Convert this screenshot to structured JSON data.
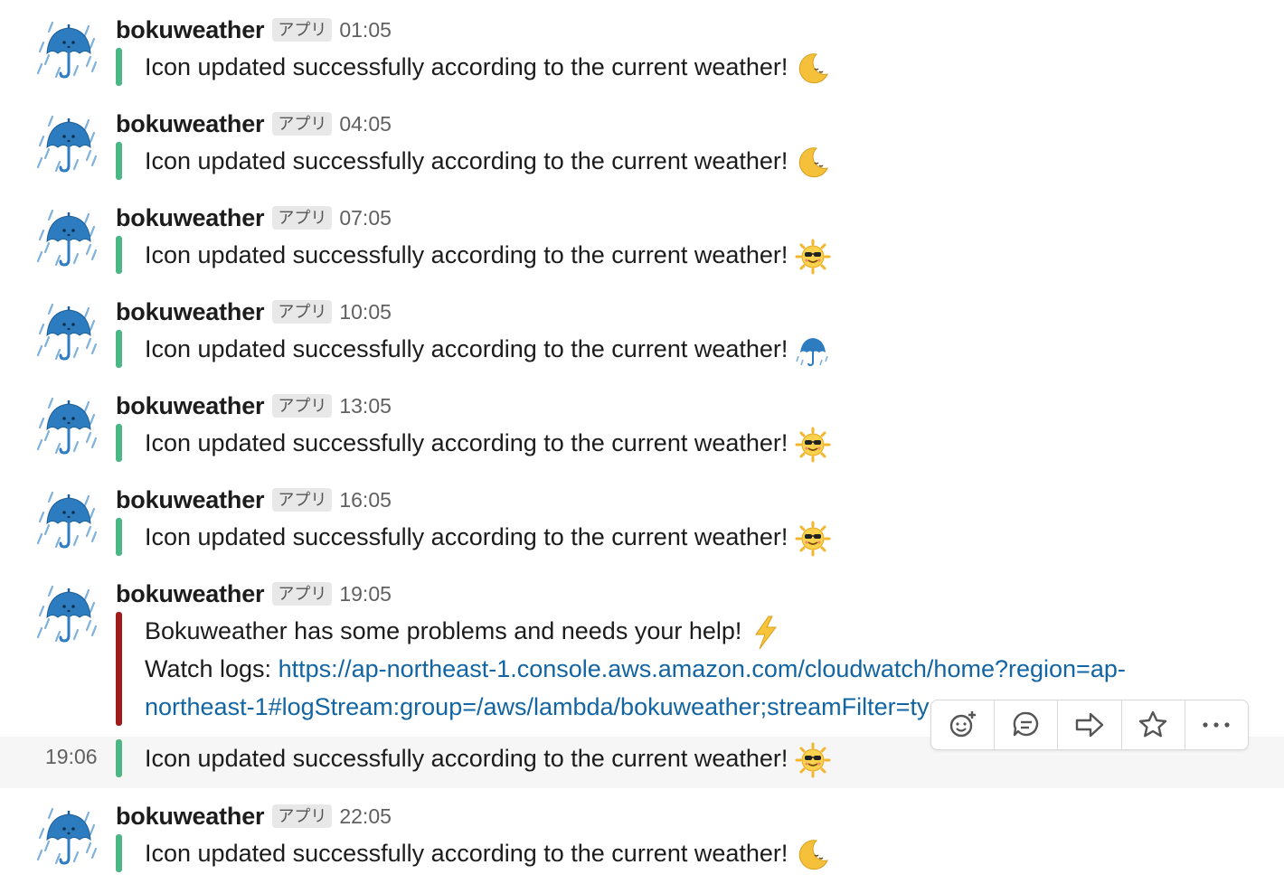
{
  "bot": {
    "name": "bokuweather",
    "badge": "アプリ"
  },
  "messages": [
    {
      "time": "01:05",
      "text": "Icon updated successfully according to the current weather!",
      "emoji": "moon-icon"
    },
    {
      "time": "04:05",
      "text": "Icon updated successfully according to the current weather!",
      "emoji": "moon-icon"
    },
    {
      "time": "07:05",
      "text": "Icon updated successfully according to the current weather!",
      "emoji": "sun-sunglasses-icon"
    },
    {
      "time": "10:05",
      "text": "Icon updated successfully according to the current weather!",
      "emoji": "umbrella-rain-icon"
    },
    {
      "time": "13:05",
      "text": "Icon updated successfully according to the current weather!",
      "emoji": "sun-sunglasses-icon"
    },
    {
      "time": "16:05",
      "text": "Icon updated successfully according to the current weather!",
      "emoji": "sun-sunglasses-icon"
    }
  ],
  "error_message": {
    "time": "19:05",
    "line1": "Bokuweather has some problems and needs your help!",
    "emoji": "lightning-icon",
    "logs_label": "Watch logs: ",
    "link_part1": "https://ap-northeast-1.console.aws.amazon.com/cloudwatch/home?region=ap-",
    "link_part2": "northeast-1#logStream:group=/aws/lambda/bokuweather;streamFilter=typeLogStreamPref"
  },
  "followup": {
    "time": "19:06",
    "text": "Icon updated successfully according to the current weather!",
    "emoji": "sun-sunglasses-icon"
  },
  "last_message": {
    "time": "22:05",
    "text": "Icon updated successfully according to the current weather!",
    "emoji": "moon-icon"
  },
  "toolbar": {
    "actions": [
      "add-reaction",
      "reply-in-thread",
      "share-message",
      "save-item",
      "more-actions"
    ]
  },
  "colors": {
    "ok_bar": "#4cb685",
    "error_bar": "#a01c1c",
    "link": "#1264a3"
  }
}
